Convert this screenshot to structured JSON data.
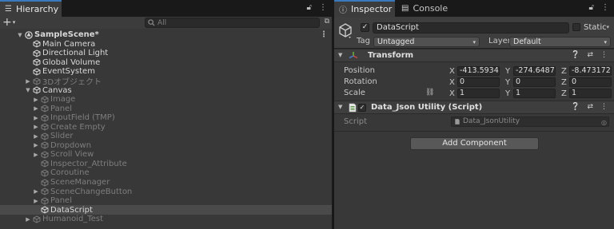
{
  "hierarchy": {
    "tab_label": "Hierarchy",
    "search_placeholder": "All",
    "rows": [
      {
        "label": "SampleScene*",
        "indent": 0,
        "arrow": "down",
        "kind": "scene",
        "bold": true,
        "inactive": false,
        "selected": false,
        "menu": true
      },
      {
        "label": "Main Camera",
        "indent": 1,
        "arrow": "",
        "kind": "cube",
        "bold": false,
        "inactive": false,
        "selected": false
      },
      {
        "label": "Directional Light",
        "indent": 1,
        "arrow": "",
        "kind": "cube",
        "bold": false,
        "inactive": false,
        "selected": false
      },
      {
        "label": "Global Volume",
        "indent": 1,
        "arrow": "",
        "kind": "cube",
        "bold": false,
        "inactive": false,
        "selected": false
      },
      {
        "label": "EventSystem",
        "indent": 1,
        "arrow": "",
        "kind": "cube",
        "bold": false,
        "inactive": false,
        "selected": false
      },
      {
        "label": "3Dオブジェクト",
        "indent": 1,
        "arrow": "right",
        "kind": "cube",
        "bold": false,
        "inactive": true,
        "selected": false
      },
      {
        "label": "Canvas",
        "indent": 1,
        "arrow": "down",
        "kind": "cube",
        "bold": false,
        "inactive": false,
        "selected": false
      },
      {
        "label": "Image",
        "indent": 2,
        "arrow": "right",
        "kind": "cube",
        "bold": false,
        "inactive": true,
        "selected": false
      },
      {
        "label": "Panel",
        "indent": 2,
        "arrow": "right",
        "kind": "cube",
        "bold": false,
        "inactive": true,
        "selected": false
      },
      {
        "label": "InputField (TMP)",
        "indent": 2,
        "arrow": "right",
        "kind": "cube",
        "bold": false,
        "inactive": true,
        "selected": false
      },
      {
        "label": "Create Empty",
        "indent": 2,
        "arrow": "right",
        "kind": "cube",
        "bold": false,
        "inactive": true,
        "selected": false
      },
      {
        "label": "Slider",
        "indent": 2,
        "arrow": "right",
        "kind": "cube",
        "bold": false,
        "inactive": true,
        "selected": false
      },
      {
        "label": "Dropdown",
        "indent": 2,
        "arrow": "right",
        "kind": "cube",
        "bold": false,
        "inactive": true,
        "selected": false
      },
      {
        "label": "Scroll View",
        "indent": 2,
        "arrow": "right",
        "kind": "cube",
        "bold": false,
        "inactive": true,
        "selected": false
      },
      {
        "label": "Inspector_Attribute",
        "indent": 2,
        "arrow": "",
        "kind": "cube",
        "bold": false,
        "inactive": true,
        "selected": false
      },
      {
        "label": "Coroutine",
        "indent": 2,
        "arrow": "",
        "kind": "cube",
        "bold": false,
        "inactive": true,
        "selected": false
      },
      {
        "label": "SceneManager",
        "indent": 2,
        "arrow": "",
        "kind": "cube",
        "bold": false,
        "inactive": true,
        "selected": false
      },
      {
        "label": "SceneChangeButton",
        "indent": 2,
        "arrow": "right",
        "kind": "cube",
        "bold": false,
        "inactive": true,
        "selected": false
      },
      {
        "label": "Panel",
        "indent": 2,
        "arrow": "right",
        "kind": "cube",
        "bold": false,
        "inactive": true,
        "selected": false
      },
      {
        "label": "DataScript",
        "indent": 2,
        "arrow": "",
        "kind": "cube",
        "bold": false,
        "inactive": false,
        "selected": true
      },
      {
        "label": "Humanoid_Test",
        "indent": 1,
        "arrow": "right",
        "kind": "cube",
        "bold": false,
        "inactive": true,
        "selected": false
      }
    ]
  },
  "inspector": {
    "tab_label": "Inspector",
    "console_tab_label": "Console",
    "object_name": "DataScript",
    "static_label": "Static",
    "tag_label": "Tag",
    "tag_value": "Untagged",
    "layer_label": "Layer",
    "layer_value": "Default",
    "transform": {
      "title": "Transform",
      "position_label": "Position",
      "rotation_label": "Rotation",
      "scale_label": "Scale",
      "position": {
        "x": "-413.5934",
        "y": "-274.6487",
        "z": "-8.473172"
      },
      "rotation": {
        "x": "0",
        "y": "0",
        "z": "0"
      },
      "scale": {
        "x": "1",
        "y": "1",
        "z": "1"
      },
      "axis_x": "X",
      "axis_y": "Y",
      "axis_z": "Z"
    },
    "script_component": {
      "title": "Data_Json Utility (Script)",
      "script_label": "Script",
      "script_value": "Data_JsonUtility"
    },
    "add_component_label": "Add Component"
  },
  "colors": {
    "panel_bg": "#383838",
    "tab_accent": "#3a79bb",
    "selected_row": "#4a4a4a",
    "transform_axis": "#e0a000"
  }
}
